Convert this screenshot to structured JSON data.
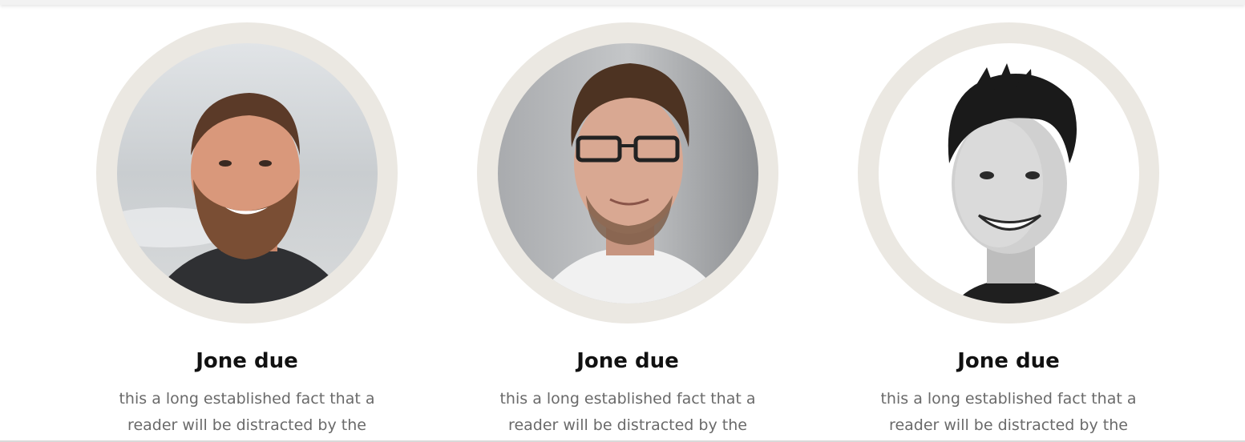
{
  "team": {
    "members": [
      {
        "name": "Jone due",
        "description": "this a long established fact that a reader will be distracted by the",
        "photo": "bearded-man-photo"
      },
      {
        "name": "Jone due",
        "description": "this a long established fact that a reader will be distracted by the",
        "photo": "man-with-glasses-photo"
      },
      {
        "name": "Jone due",
        "description": "this a long established fact that a reader will be distracted by the",
        "photo": "smiling-young-man-bw-photo"
      }
    ]
  },
  "colors": {
    "ring": "#ebe8e2",
    "name": "#111111",
    "description": "#6a6a6a"
  }
}
